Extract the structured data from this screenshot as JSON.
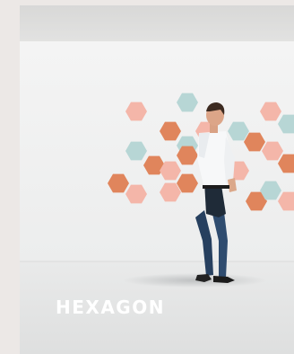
{
  "tile": {
    "title": "HEXAGON"
  },
  "colors": {
    "ceiling": "#dcdcdb",
    "wall": "#f2f3f3",
    "floor": "#e4e5e5",
    "hex_orange": "#e0855c",
    "hex_pink": "#f4b6a9",
    "hex_blue": "#b7d6d5",
    "caption_text": "#ffffff"
  },
  "image": {
    "subject": "man-walking-icon",
    "decor": "hexagon-wall-tiles-icon"
  }
}
